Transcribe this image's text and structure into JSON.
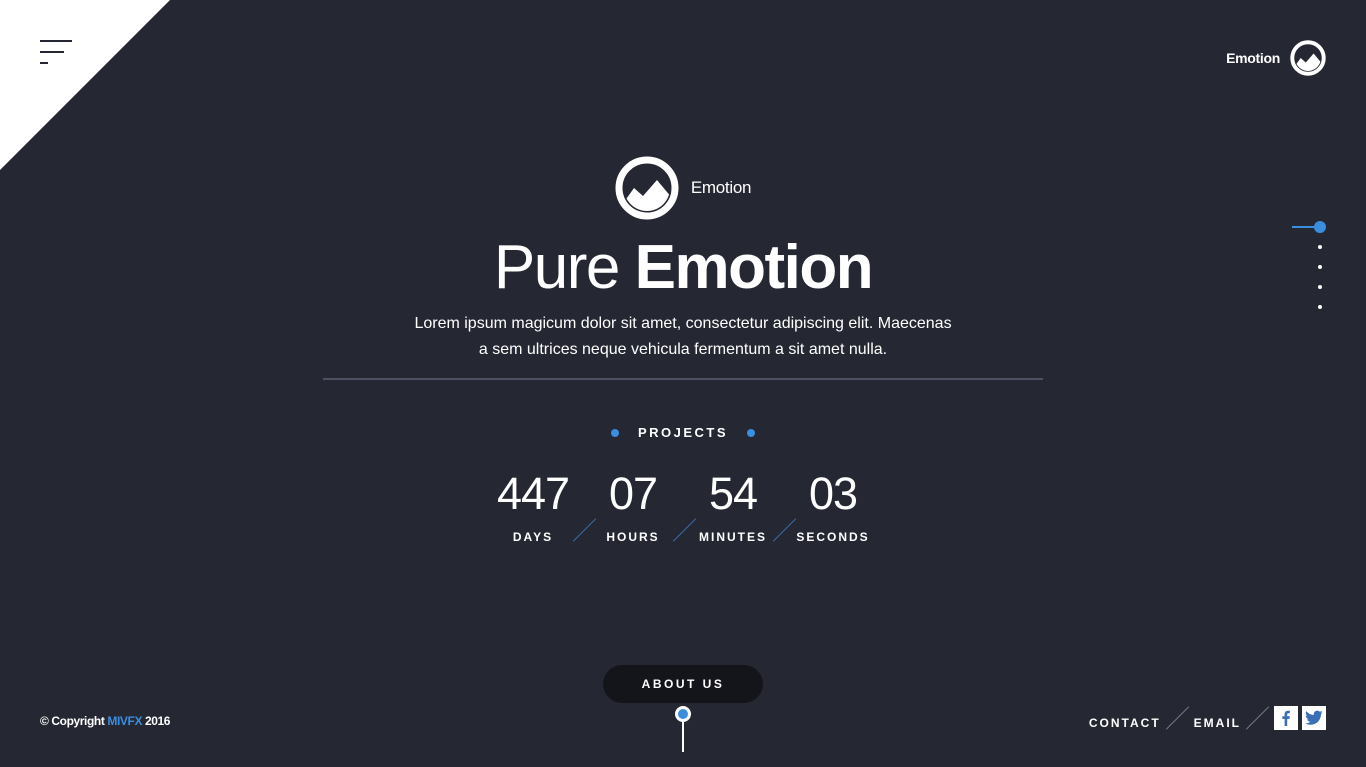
{
  "header": {
    "brand_name": "Emotion",
    "menu_icon": "hamburger-menu-icon",
    "logo_icon": "mountain-circle-logo-icon"
  },
  "hero": {
    "logo_name": "Emotion",
    "title_light": "Pure",
    "title_bold": "Emotion",
    "description_line1": "Lorem ipsum magicum dolor sit amet, consectetur adipiscing elit. Maecenas",
    "description_line2": "a sem ultrices neque vehicula fermentum a sit amet nulla."
  },
  "countdown": {
    "heading": "PROJECTS",
    "units": [
      {
        "value": "447",
        "label": "DAYS"
      },
      {
        "value": "07",
        "label": "HOURS"
      },
      {
        "value": "54",
        "label": "MINUTES"
      },
      {
        "value": "03",
        "label": "SECONDS"
      }
    ]
  },
  "side_nav": {
    "count": 5,
    "active_index": 0
  },
  "about_button": {
    "label": "ABOUT US"
  },
  "footer": {
    "copyright_prefix": "© Copyright",
    "copyright_brand": "MIVFX",
    "copyright_year": "2016",
    "contact_label": "CONTACT",
    "email_label": "EMAIL",
    "social": [
      "facebook-icon",
      "twitter-icon"
    ]
  },
  "colors": {
    "background": "#252832",
    "accent": "#3b8de0",
    "button": "#14151b",
    "text": "#ffffff"
  }
}
